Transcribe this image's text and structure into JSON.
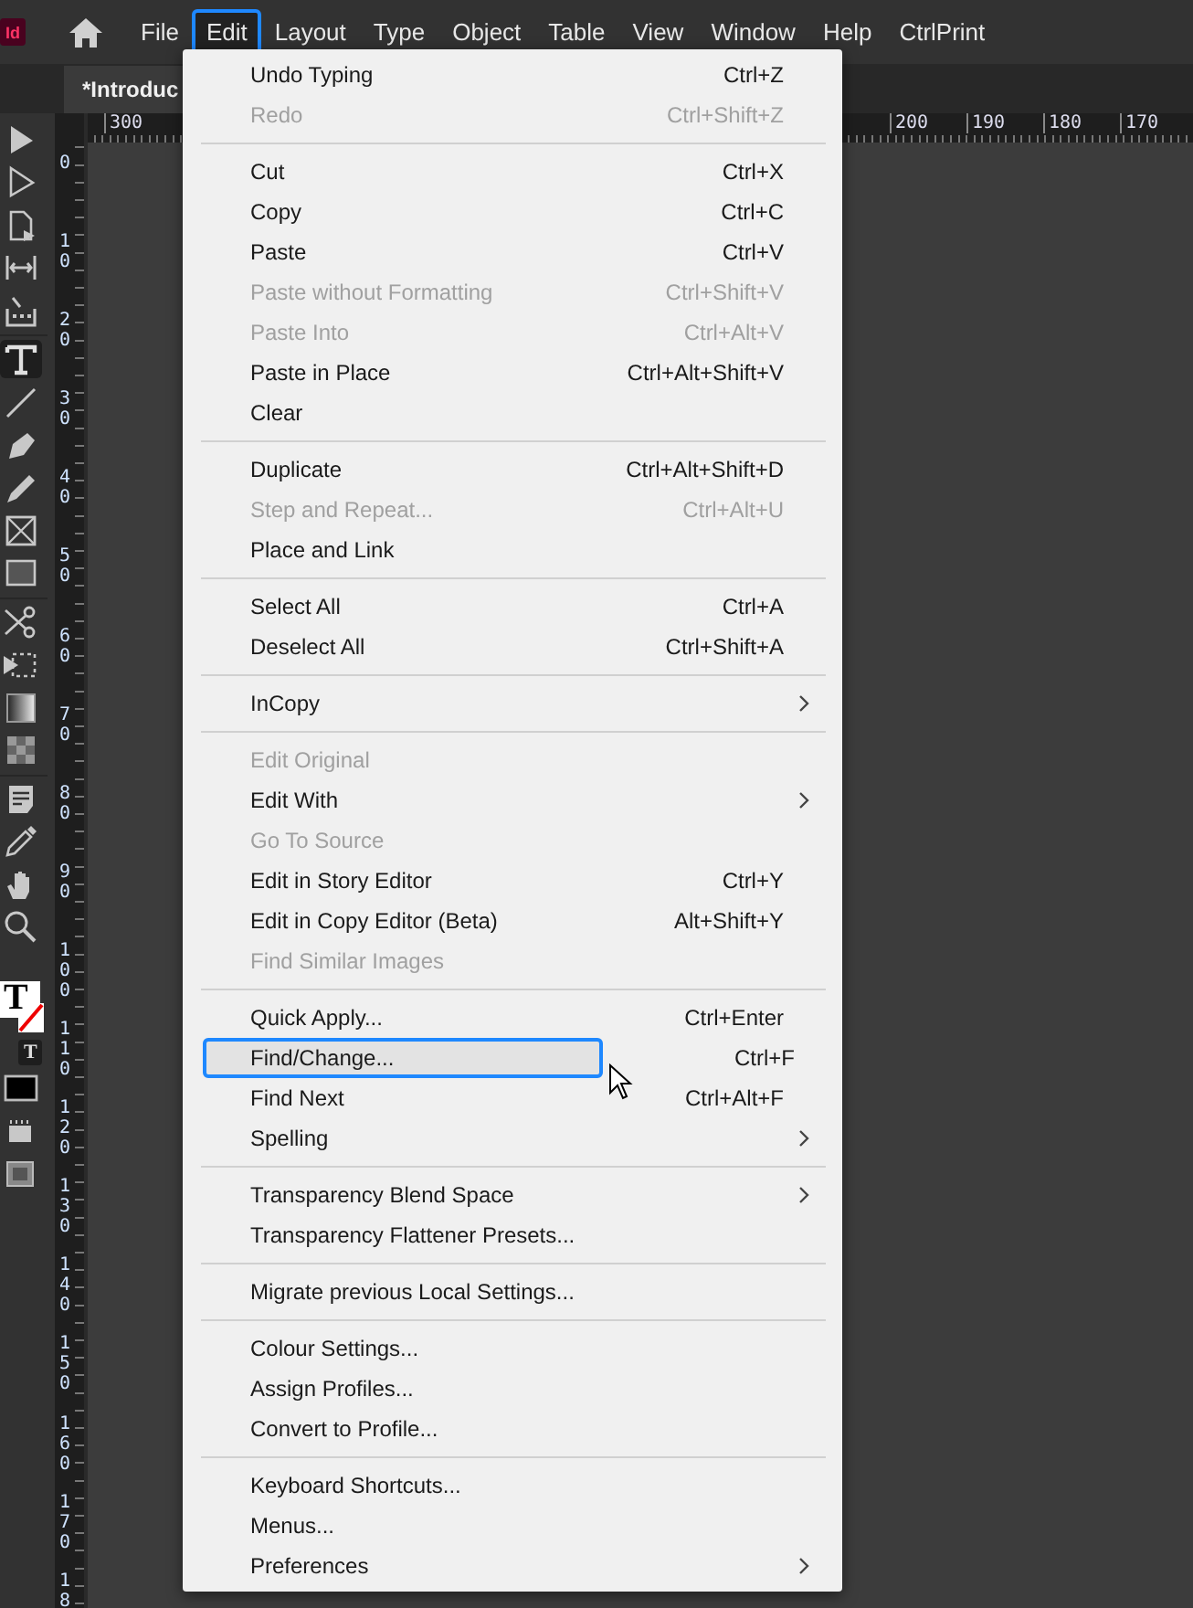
{
  "app": {
    "logo": "Id"
  },
  "menubar": [
    {
      "label": "File",
      "selected": false
    },
    {
      "label": "Edit",
      "selected": true
    },
    {
      "label": "Layout",
      "selected": false
    },
    {
      "label": "Type",
      "selected": false
    },
    {
      "label": "Object",
      "selected": false
    },
    {
      "label": "Table",
      "selected": false
    },
    {
      "label": "View",
      "selected": false
    },
    {
      "label": "Window",
      "selected": false
    },
    {
      "label": "Help",
      "selected": false
    },
    {
      "label": "CtrlPrint",
      "selected": false
    }
  ],
  "document_tab": {
    "title": "*Introduc"
  },
  "top_ruler": {
    "labels": [
      "300",
      "200",
      "190",
      "180",
      "170"
    ]
  },
  "left_ruler": {
    "labels": [
      "0",
      "10",
      "20",
      "30",
      "40",
      "50",
      "60",
      "70",
      "80",
      "90",
      "100",
      "110",
      "120",
      "130",
      "140",
      "150",
      "160",
      "170",
      "18"
    ]
  },
  "tools": [
    {
      "kind": "selection",
      "selected": false
    },
    {
      "kind": "direct",
      "selected": false
    },
    {
      "kind": "page",
      "selected": false
    },
    {
      "kind": "gap",
      "selected": false
    },
    {
      "kind": "collector",
      "selected": false
    },
    {
      "kind": "type",
      "selected": true
    },
    {
      "kind": "line",
      "selected": false
    },
    {
      "kind": "pen",
      "selected": false
    },
    {
      "kind": "pencil",
      "selected": false
    },
    {
      "kind": "frame",
      "selected": false
    },
    {
      "kind": "rectangle",
      "selected": false
    },
    {
      "kind": "scissors",
      "selected": false
    },
    {
      "kind": "transform",
      "selected": false
    },
    {
      "kind": "gradient",
      "selected": false
    },
    {
      "kind": "feather",
      "selected": false
    },
    {
      "kind": "note",
      "selected": false
    },
    {
      "kind": "eyedropper",
      "selected": false
    },
    {
      "kind": "hand",
      "selected": false
    },
    {
      "kind": "zoom",
      "selected": false
    }
  ],
  "fill_stroke": {
    "glyph": "T",
    "small_glyph": "T"
  },
  "edit_menu": [
    [
      {
        "label": "Undo Typing",
        "shortcut": "Ctrl+Z",
        "disabled": false,
        "submenu": false,
        "selected": false
      },
      {
        "label": "Redo",
        "shortcut": "Ctrl+Shift+Z",
        "disabled": true,
        "submenu": false,
        "selected": false
      }
    ],
    [
      {
        "label": "Cut",
        "shortcut": "Ctrl+X",
        "disabled": false,
        "submenu": false,
        "selected": false
      },
      {
        "label": "Copy",
        "shortcut": "Ctrl+C",
        "disabled": false,
        "submenu": false,
        "selected": false
      },
      {
        "label": "Paste",
        "shortcut": "Ctrl+V",
        "disabled": false,
        "submenu": false,
        "selected": false
      },
      {
        "label": "Paste without Formatting",
        "shortcut": "Ctrl+Shift+V",
        "disabled": true,
        "submenu": false,
        "selected": false
      },
      {
        "label": "Paste Into",
        "shortcut": "Ctrl+Alt+V",
        "disabled": true,
        "submenu": false,
        "selected": false
      },
      {
        "label": "Paste in Place",
        "shortcut": "Ctrl+Alt+Shift+V",
        "disabled": false,
        "submenu": false,
        "selected": false
      },
      {
        "label": "Clear",
        "disabled": false,
        "submenu": false,
        "selected": false
      }
    ],
    [
      {
        "label": "Duplicate",
        "shortcut": "Ctrl+Alt+Shift+D",
        "disabled": false,
        "submenu": false,
        "selected": false
      },
      {
        "label": "Step and Repeat...",
        "shortcut": "Ctrl+Alt+U",
        "disabled": true,
        "submenu": false,
        "selected": false
      },
      {
        "label": "Place and Link",
        "disabled": false,
        "submenu": false,
        "selected": false
      }
    ],
    [
      {
        "label": "Select All",
        "shortcut": "Ctrl+A",
        "disabled": false,
        "submenu": false,
        "selected": false
      },
      {
        "label": "Deselect All",
        "shortcut": "Ctrl+Shift+A",
        "disabled": false,
        "submenu": false,
        "selected": false
      }
    ],
    [
      {
        "label": "InCopy",
        "disabled": false,
        "submenu": true,
        "selected": false
      }
    ],
    [
      {
        "label": "Edit Original",
        "disabled": true,
        "submenu": false,
        "selected": false
      },
      {
        "label": "Edit With",
        "disabled": false,
        "submenu": true,
        "selected": false
      },
      {
        "label": "Go To Source",
        "disabled": true,
        "submenu": false,
        "selected": false
      },
      {
        "label": "Edit in Story Editor",
        "shortcut": "Ctrl+Y",
        "disabled": false,
        "submenu": false,
        "selected": false
      },
      {
        "label": "Edit in Copy Editor (Beta)",
        "shortcut": "Alt+Shift+Y",
        "disabled": false,
        "submenu": false,
        "selected": false
      },
      {
        "label": "Find Similar Images",
        "disabled": true,
        "submenu": false,
        "selected": false
      }
    ],
    [
      {
        "label": "Quick Apply...",
        "shortcut": "Ctrl+Enter",
        "disabled": false,
        "submenu": false,
        "selected": false
      },
      {
        "label": "Find/Change...",
        "shortcut": "Ctrl+F",
        "disabled": false,
        "submenu": false,
        "selected": true
      },
      {
        "label": "Find Next",
        "shortcut": "Ctrl+Alt+F",
        "disabled": false,
        "submenu": false,
        "selected": false
      },
      {
        "label": "Spelling",
        "disabled": false,
        "submenu": true,
        "selected": false
      }
    ],
    [
      {
        "label": "Transparency Blend Space",
        "disabled": false,
        "submenu": true,
        "selected": false
      },
      {
        "label": "Transparency Flattener Presets...",
        "disabled": false,
        "submenu": false,
        "selected": false
      }
    ],
    [
      {
        "label": "Migrate previous Local Settings...",
        "disabled": false,
        "submenu": false,
        "selected": false
      }
    ],
    [
      {
        "label": "Colour Settings...",
        "disabled": false,
        "submenu": false,
        "selected": false
      },
      {
        "label": "Assign Profiles...",
        "disabled": false,
        "submenu": false,
        "selected": false
      },
      {
        "label": "Convert to Profile...",
        "disabled": false,
        "submenu": false,
        "selected": false
      }
    ],
    [
      {
        "label": "Keyboard Shortcuts...",
        "disabled": false,
        "submenu": false,
        "selected": false
      },
      {
        "label": "Menus...",
        "disabled": false,
        "submenu": false,
        "selected": false
      },
      {
        "label": "Preferences",
        "disabled": false,
        "submenu": true,
        "selected": false
      }
    ]
  ]
}
